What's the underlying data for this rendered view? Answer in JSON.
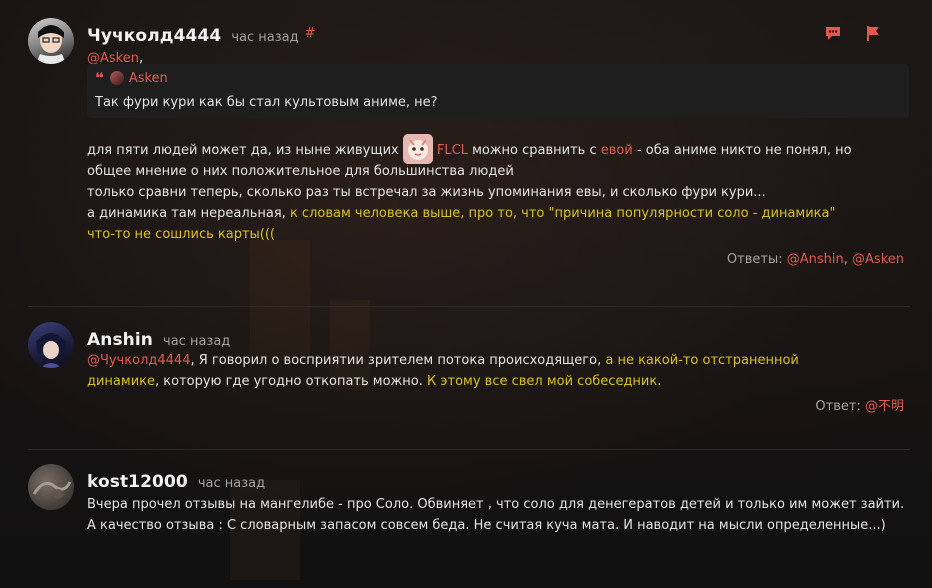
{
  "colors": {
    "mention": "#e05a4f",
    "highlight": "#d9c21d",
    "muted": "#a2a2a2",
    "text": "#e4e4e4"
  },
  "comments": [
    {
      "username": "Чучколд4444",
      "time": "час назад",
      "hash": "#",
      "mention": "@Asken",
      "mention_suffix": ",",
      "quote": {
        "author": "Asken",
        "text": "Так фури кури как бы стал культовым аниме, не?"
      },
      "actions": [
        "reply-icon",
        "flag-icon"
      ],
      "lines": {
        "l1_a": "для пяти людей может да, из ныне живущих",
        "l1_flcl": "FLCL",
        "l1_b": "можно сравнить с",
        "l1_evoy": "евой",
        "l1_c": "- оба аниме никто не понял, но",
        "l2": "общее мнение о них положительное для большинства людей",
        "l3": "только сравни теперь, сколько раз ты встречал за жизнь упоминания евы, и сколько фури кури...",
        "l4_a": "а динамика там нереальная,",
        "l4_hl": "к словам человека выше, про то, что \"причина популярности соло - динамика\"",
        "l5_hl": "что-то не сошлись карты(((",
        "replies_label": "Ответы:",
        "replies": [
          "@Anshin",
          "@Asken"
        ]
      }
    },
    {
      "username": "Anshin",
      "time": "час назад",
      "lines": {
        "l1_mention": "@Чучколд4444",
        "l1_a": ", Я говорил о восприятии зрителем потока происходящего,",
        "l1_hl": "а не какой-то отстраненной",
        "l2_hl": "динамике",
        "l2_a": ", которую где угодно откопать можно.",
        "l2_hl2": "К этому все свел мой собеседник.",
        "reply_label": "Ответ:",
        "reply": "@不明"
      }
    },
    {
      "username": "kost12000",
      "time": "час назад",
      "text": "Вчера прочел отзывы на мангелибе - про Соло. Обвиняет , что соло для денегератов детей и только им может зайти. А качество отзыва : С словарным запасом совсем беда. Не считая куча мата. И наводит на мысли определенные...)"
    }
  ]
}
